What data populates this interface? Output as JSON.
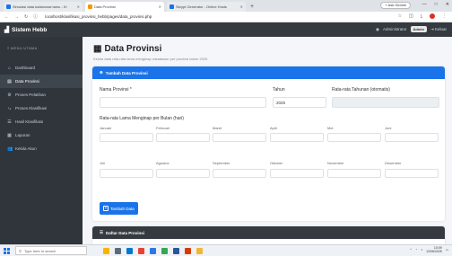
{
  "browser": {
    "tabs": [
      {
        "label": "Simulasi data kolaborasi tamu - Kl",
        "fav_color": "#1a73e8",
        "active": false
      },
      {
        "label": "Data Provinsi",
        "fav_color": "#f29900",
        "active": true
      },
      {
        "label": "Skrypt Generator - Online Hosts",
        "fav_color": "#1a73e8",
        "active": false
      }
    ],
    "new_tab": "+",
    "ask_button": "+ Ask Gemini",
    "url": "localhost/klasifikasi_provinsi_hebb/pages/data_provinsi.php"
  },
  "app": {
    "brand": "Sistem Hebb",
    "user": "Administrator",
    "role": "Admin",
    "logout": "Keluar"
  },
  "sidebar": {
    "heading": "MENU UTAMA",
    "items": [
      {
        "label": "Dashboard",
        "icon": "dashboard-icon",
        "glyph": "⌂",
        "active": false
      },
      {
        "label": "Data Provinsi",
        "icon": "table-icon",
        "glyph": "▤",
        "active": true
      },
      {
        "label": "Proses Pelatihan",
        "icon": "gear-icon",
        "glyph": "⚙",
        "active": false
      },
      {
        "label": "Proses Klasifikasi",
        "icon": "flow-icon",
        "glyph": "⤷",
        "active": false
      },
      {
        "label": "Hasil Klasifikasi",
        "icon": "list-icon",
        "glyph": "☰",
        "active": false
      },
      {
        "label": "Laporan",
        "icon": "report-icon",
        "glyph": "▦",
        "active": false
      },
      {
        "label": "Kelola Akun",
        "icon": "users-icon",
        "glyph": "👥",
        "active": false
      }
    ]
  },
  "main": {
    "title": "Data Provinsi",
    "subtitle": "Kelola data rata-rata lama menginap wisatawan per provinsi tahun 2025",
    "form_card": {
      "header": "Tambah Data Provinsi",
      "nama_label": "Nama Provinsi *",
      "tahun_label": "Tahun",
      "tahun_value": "2025",
      "rata_label": "Rata-rata Tahunan (otomatis)",
      "monthly_label": "Rata-rata Lama Menginap per Bulan (hari)",
      "months_row1": [
        "Januari",
        "Februari",
        "Maret",
        "April",
        "Mei",
        "Juni"
      ],
      "months_row2": [
        "Juli",
        "Agustus",
        "September",
        "Oktober",
        "November",
        "Desember"
      ],
      "add_button": "Tambah Data"
    },
    "list_card": {
      "header": "Daftar Data Provinsi"
    }
  },
  "taskbar": {
    "search_placeholder": "Type here to search",
    "time": "10:09",
    "date": "12/06/2025"
  },
  "colors": {
    "primary": "#1a73e8",
    "sidebar_bg": "#2f353b",
    "topbar_bg": "#343a40"
  }
}
